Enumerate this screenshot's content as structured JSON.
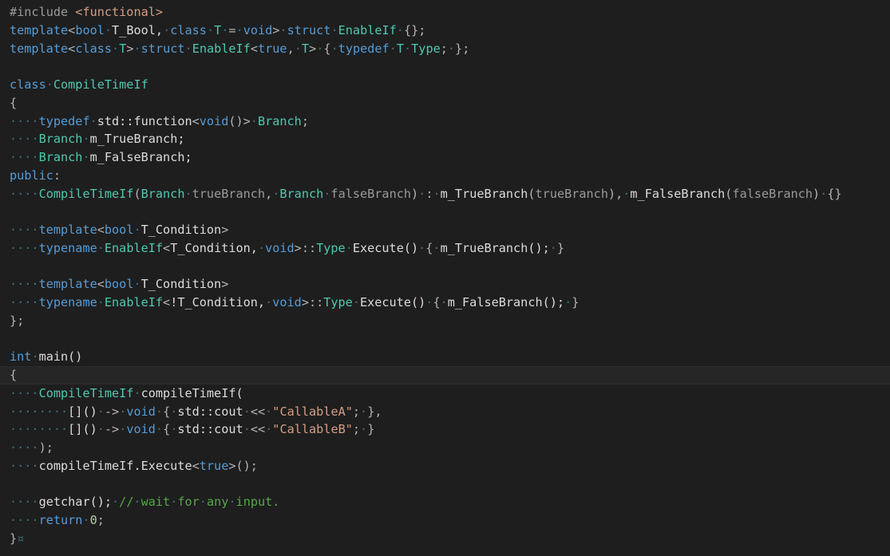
{
  "colors": {
    "background": "#1e1e1e",
    "keyword": "#569cd6",
    "type": "#4ec9b0",
    "string": "#d69d85",
    "comment": "#57a64a",
    "parameter": "#9a9a9a",
    "plain": "#dcdcdc",
    "whitespace_marker": "#3f6f78"
  },
  "editor": {
    "current_line": 20,
    "lines": [
      [
        [
          "pp",
          "#include "
        ],
        [
          "inc",
          "<functional>"
        ]
      ],
      [
        [
          "kw",
          "template"
        ],
        [
          "punct",
          "<"
        ],
        [
          "kw",
          "bool"
        ],
        [
          "ws",
          "·"
        ],
        [
          "plain",
          "T_Bool,"
        ],
        [
          "ws",
          "·"
        ],
        [
          "kw",
          "class"
        ],
        [
          "ws",
          "·"
        ],
        [
          "type",
          "T"
        ],
        [
          "ws",
          "·"
        ],
        [
          "punct",
          "="
        ],
        [
          "ws",
          "·"
        ],
        [
          "kw",
          "void"
        ],
        [
          "punct",
          ">"
        ],
        [
          "ws",
          "·"
        ],
        [
          "kw",
          "struct"
        ],
        [
          "ws",
          "·"
        ],
        [
          "type",
          "EnableIf"
        ],
        [
          "ws",
          "·"
        ],
        [
          "punct",
          "{};"
        ]
      ],
      [
        [
          "kw",
          "template"
        ],
        [
          "punct",
          "<"
        ],
        [
          "kw",
          "class"
        ],
        [
          "ws",
          "·"
        ],
        [
          "type",
          "T"
        ],
        [
          "punct",
          ">"
        ],
        [
          "ws",
          "·"
        ],
        [
          "kw",
          "struct"
        ],
        [
          "ws",
          "·"
        ],
        [
          "type",
          "EnableIf"
        ],
        [
          "punct",
          "<"
        ],
        [
          "kw",
          "true"
        ],
        [
          "punct",
          ","
        ],
        [
          "ws",
          "·"
        ],
        [
          "type",
          "T"
        ],
        [
          "punct",
          ">"
        ],
        [
          "ws",
          "·"
        ],
        [
          "punct",
          "{"
        ],
        [
          "ws",
          "·"
        ],
        [
          "kw",
          "typedef"
        ],
        [
          "ws",
          "·"
        ],
        [
          "type",
          "T"
        ],
        [
          "ws",
          "·"
        ],
        [
          "type",
          "Type"
        ],
        [
          "punct",
          ";"
        ],
        [
          "ws",
          "·"
        ],
        [
          "punct",
          "};"
        ]
      ],
      [],
      [
        [
          "kw",
          "class"
        ],
        [
          "ws",
          "·"
        ],
        [
          "type",
          "CompileTimeIf"
        ]
      ],
      [
        [
          "punct",
          "{"
        ]
      ],
      [
        [
          "ws",
          "····"
        ],
        [
          "kw",
          "typedef"
        ],
        [
          "ws",
          "·"
        ],
        [
          "plain",
          "std::function"
        ],
        [
          "punct",
          "<"
        ],
        [
          "kw",
          "void"
        ],
        [
          "punct",
          "()>"
        ],
        [
          "ws",
          "·"
        ],
        [
          "type",
          "Branch"
        ],
        [
          "punct",
          ";"
        ]
      ],
      [
        [
          "ws",
          "····"
        ],
        [
          "type",
          "Branch"
        ],
        [
          "ws",
          "·"
        ],
        [
          "plain",
          "m_TrueBranch;"
        ]
      ],
      [
        [
          "ws",
          "····"
        ],
        [
          "type",
          "Branch"
        ],
        [
          "ws",
          "·"
        ],
        [
          "plain",
          "m_FalseBranch;"
        ]
      ],
      [
        [
          "kw",
          "public"
        ],
        [
          "punct",
          ":"
        ]
      ],
      [
        [
          "ws",
          "····"
        ],
        [
          "type",
          "CompileTimeIf"
        ],
        [
          "punct",
          "("
        ],
        [
          "type",
          "Branch"
        ],
        [
          "ws",
          "·"
        ],
        [
          "param",
          "trueBranch"
        ],
        [
          "punct",
          ","
        ],
        [
          "ws",
          "·"
        ],
        [
          "type",
          "Branch"
        ],
        [
          "ws",
          "·"
        ],
        [
          "param",
          "falseBranch"
        ],
        [
          "punct",
          ")"
        ],
        [
          "ws",
          "·"
        ],
        [
          "punct",
          ":"
        ],
        [
          "ws",
          "·"
        ],
        [
          "plain",
          "m_TrueBranch"
        ],
        [
          "punct",
          "("
        ],
        [
          "param",
          "trueBranch"
        ],
        [
          "punct",
          "),"
        ],
        [
          "ws",
          "·"
        ],
        [
          "plain",
          "m_FalseBranch"
        ],
        [
          "punct",
          "("
        ],
        [
          "param",
          "falseBranch"
        ],
        [
          "punct",
          ")"
        ],
        [
          "ws",
          "·"
        ],
        [
          "punct",
          "{}"
        ]
      ],
      [],
      [
        [
          "ws",
          "····"
        ],
        [
          "kw",
          "template"
        ],
        [
          "punct",
          "<"
        ],
        [
          "kw",
          "bool"
        ],
        [
          "ws",
          "·"
        ],
        [
          "plain",
          "T_Condition"
        ],
        [
          "punct",
          ">"
        ]
      ],
      [
        [
          "ws",
          "····"
        ],
        [
          "kw",
          "typename"
        ],
        [
          "ws",
          "·"
        ],
        [
          "type",
          "EnableIf"
        ],
        [
          "punct",
          "<"
        ],
        [
          "plain",
          "T_Condition,"
        ],
        [
          "ws",
          "·"
        ],
        [
          "kw",
          "void"
        ],
        [
          "punct",
          ">::"
        ],
        [
          "type",
          "Type"
        ],
        [
          "ws",
          "·"
        ],
        [
          "plain",
          "Execute()"
        ],
        [
          "ws",
          "·"
        ],
        [
          "punct",
          "{"
        ],
        [
          "ws",
          "·"
        ],
        [
          "plain",
          "m_TrueBranch();"
        ],
        [
          "ws",
          "·"
        ],
        [
          "punct",
          "}"
        ]
      ],
      [],
      [
        [
          "ws",
          "····"
        ],
        [
          "kw",
          "template"
        ],
        [
          "punct",
          "<"
        ],
        [
          "kw",
          "bool"
        ],
        [
          "ws",
          "·"
        ],
        [
          "plain",
          "T_Condition"
        ],
        [
          "punct",
          ">"
        ]
      ],
      [
        [
          "ws",
          "····"
        ],
        [
          "kw",
          "typename"
        ],
        [
          "ws",
          "·"
        ],
        [
          "type",
          "EnableIf"
        ],
        [
          "punct",
          "<"
        ],
        [
          "plain",
          "!T_Condition,"
        ],
        [
          "ws",
          "·"
        ],
        [
          "kw",
          "void"
        ],
        [
          "punct",
          ">::"
        ],
        [
          "type",
          "Type"
        ],
        [
          "ws",
          "·"
        ],
        [
          "plain",
          "Execute()"
        ],
        [
          "ws",
          "·"
        ],
        [
          "punct",
          "{"
        ],
        [
          "ws",
          "·"
        ],
        [
          "plain",
          "m_FalseBranch();"
        ],
        [
          "ws",
          "·"
        ],
        [
          "punct",
          "}"
        ]
      ],
      [
        [
          "punct",
          "};"
        ]
      ],
      [],
      [
        [
          "kw",
          "int"
        ],
        [
          "ws",
          "·"
        ],
        [
          "plain",
          "main()"
        ]
      ],
      [
        [
          "punct",
          "{"
        ]
      ],
      [
        [
          "ws",
          "····"
        ],
        [
          "type",
          "CompileTimeIf"
        ],
        [
          "ws",
          "·"
        ],
        [
          "plain",
          "compileTimeIf("
        ]
      ],
      [
        [
          "ws",
          "········"
        ],
        [
          "plain",
          "[]()"
        ],
        [
          "ws",
          "·"
        ],
        [
          "punct",
          "->"
        ],
        [
          "ws",
          "·"
        ],
        [
          "kw",
          "void"
        ],
        [
          "ws",
          "·"
        ],
        [
          "punct",
          "{"
        ],
        [
          "ws",
          "·"
        ],
        [
          "plain",
          "std::cout"
        ],
        [
          "ws",
          "·"
        ],
        [
          "punct",
          "<<"
        ],
        [
          "ws",
          "·"
        ],
        [
          "str",
          "\"CallableA\""
        ],
        [
          "punct",
          ";"
        ],
        [
          "ws",
          "·"
        ],
        [
          "punct",
          "},"
        ]
      ],
      [
        [
          "ws",
          "········"
        ],
        [
          "plain",
          "[]()"
        ],
        [
          "ws",
          "·"
        ],
        [
          "punct",
          "->"
        ],
        [
          "ws",
          "·"
        ],
        [
          "kw",
          "void"
        ],
        [
          "ws",
          "·"
        ],
        [
          "punct",
          "{"
        ],
        [
          "ws",
          "·"
        ],
        [
          "plain",
          "std::cout"
        ],
        [
          "ws",
          "·"
        ],
        [
          "punct",
          "<<"
        ],
        [
          "ws",
          "·"
        ],
        [
          "str",
          "\"CallableB\""
        ],
        [
          "punct",
          ";"
        ],
        [
          "ws",
          "·"
        ],
        [
          "punct",
          "}"
        ]
      ],
      [
        [
          "ws",
          "····"
        ],
        [
          "punct",
          ");"
        ]
      ],
      [
        [
          "ws",
          "····"
        ],
        [
          "plain",
          "compileTimeIf.Execute"
        ],
        [
          "punct",
          "<"
        ],
        [
          "kw",
          "true"
        ],
        [
          "punct",
          ">();"
        ]
      ],
      [],
      [
        [
          "ws",
          "····"
        ],
        [
          "plain",
          "getchar();"
        ],
        [
          "ws",
          "·"
        ],
        [
          "cmt",
          "//"
        ],
        [
          "ws",
          "·"
        ],
        [
          "cmt",
          "wait"
        ],
        [
          "ws",
          "·"
        ],
        [
          "cmt",
          "for"
        ],
        [
          "ws",
          "·"
        ],
        [
          "cmt",
          "any"
        ],
        [
          "ws",
          "·"
        ],
        [
          "cmt",
          "input."
        ]
      ],
      [
        [
          "ws",
          "····"
        ],
        [
          "kw",
          "return"
        ],
        [
          "ws",
          "·"
        ],
        [
          "num",
          "0"
        ],
        [
          "punct",
          ";"
        ]
      ],
      [
        [
          "punct",
          "}"
        ],
        [
          "ws",
          "¤"
        ]
      ]
    ]
  }
}
